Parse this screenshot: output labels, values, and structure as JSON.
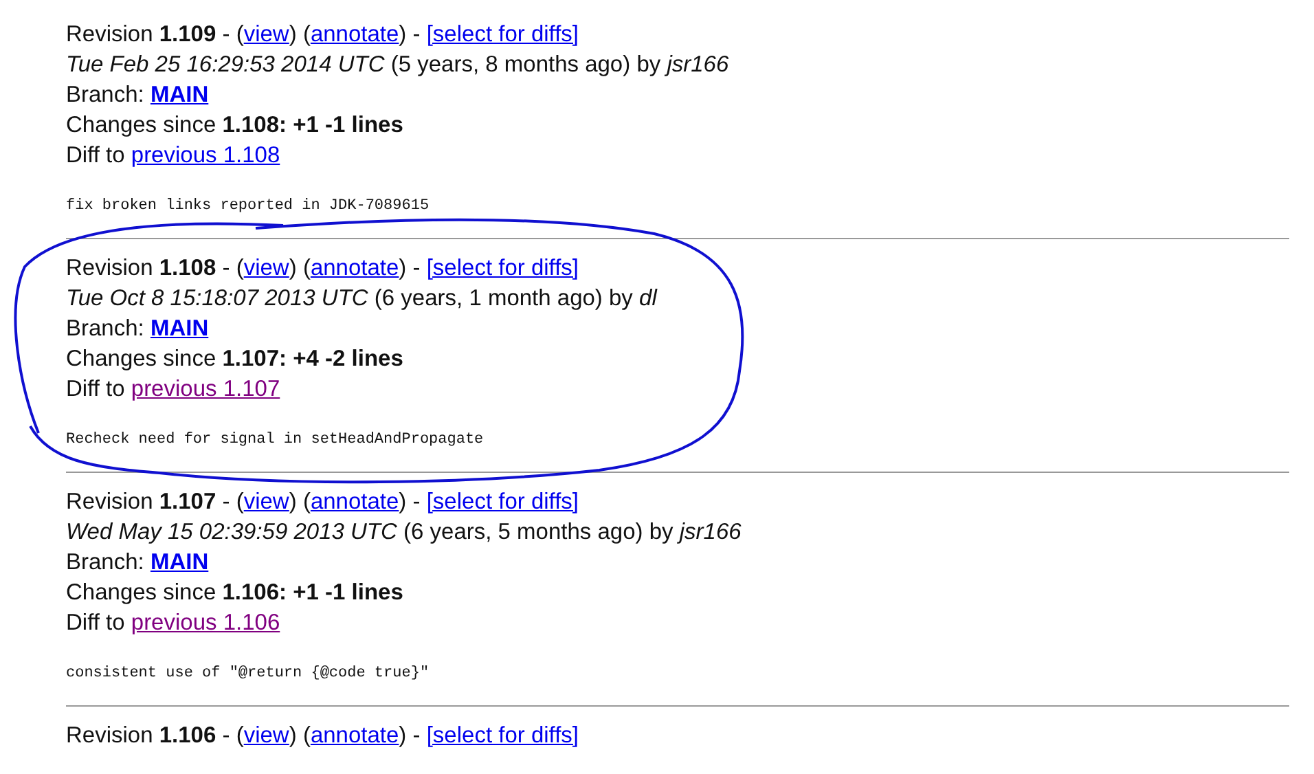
{
  "revisions": [
    {
      "circled": false,
      "revision_line": [
        {
          "kind": "text",
          "text": "Revision **1.109** - ("
        },
        {
          "kind": "link",
          "text": "view"
        },
        {
          "kind": "text",
          "text": ") ("
        },
        {
          "kind": "link",
          "text": "annotate"
        },
        {
          "kind": "text",
          "text": ") - "
        },
        {
          "kind": "link",
          "text": "[select for diffs]"
        }
      ],
      "date": "Tue Feb 25 16:29:53 2014 UTC",
      "age": "(5 years, 8 months ago) by",
      "author": "jsr166",
      "branch_label": "Branch:",
      "branch": "MAIN",
      "changes": "Changes since **1.108: +1 -1 lines**",
      "diff_label": "Diff to",
      "diff_link": {
        "text": "previous 1.108",
        "visited": false
      },
      "message": "fix broken links reported in JDK-7089615"
    },
    {
      "circled": true,
      "revision_line": [
        {
          "kind": "text",
          "text": "Revision **1.108** - ("
        },
        {
          "kind": "link",
          "text": "view"
        },
        {
          "kind": "text",
          "text": ") ("
        },
        {
          "kind": "link",
          "text": "annotate"
        },
        {
          "kind": "text",
          "text": ") - "
        },
        {
          "kind": "link",
          "text": "[select for diffs]"
        }
      ],
      "date": "Tue Oct 8 15:18:07 2013 UTC",
      "age": "(6 years, 1 month ago) by",
      "author": "dl",
      "branch_label": "Branch:",
      "branch": "MAIN",
      "changes": "Changes since **1.107: +4 -2 lines**",
      "diff_label": "Diff to",
      "diff_link": {
        "text": "previous 1.107",
        "visited": true
      },
      "message": "Recheck need for signal in setHeadAndPropagate"
    },
    {
      "circled": false,
      "revision_line": [
        {
          "kind": "text",
          "text": "Revision **1.107** - ("
        },
        {
          "kind": "link",
          "text": "view"
        },
        {
          "kind": "text",
          "text": ") ("
        },
        {
          "kind": "link",
          "text": "annotate"
        },
        {
          "kind": "text",
          "text": ") - "
        },
        {
          "kind": "link",
          "text": "[select for diffs]"
        }
      ],
      "date": "Wed May 15 02:39:59 2013 UTC",
      "age": "(6 years, 5 months ago) by",
      "author": "jsr166",
      "branch_label": "Branch:",
      "branch": "MAIN",
      "changes": "Changes since **1.106: +1 -1 lines**",
      "diff_label": "Diff to",
      "diff_link": {
        "text": "previous 1.106",
        "visited": true
      },
      "message": "consistent use of \"@return {@code true}\""
    },
    {
      "circled": false,
      "revision_line": [
        {
          "kind": "text",
          "text": "Revision **1.106** - ("
        },
        {
          "kind": "link",
          "text": "view"
        },
        {
          "kind": "text",
          "text": ") ("
        },
        {
          "kind": "link",
          "text": "annotate"
        },
        {
          "kind": "text",
          "text": ") - "
        },
        {
          "kind": "link",
          "text": "[select for diffs]"
        }
      ]
    }
  ]
}
